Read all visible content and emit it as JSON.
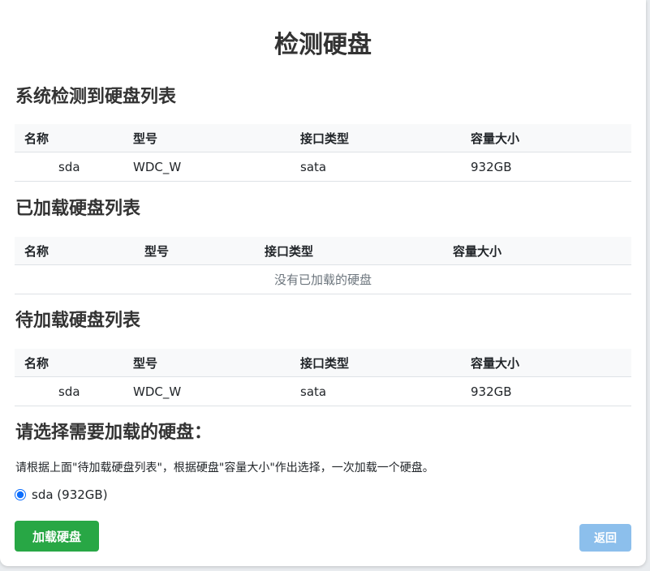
{
  "page_title": "检测硬盘",
  "detected": {
    "title": "系统检测到硬盘列表",
    "columns": [
      "名称",
      "型号",
      "接口类型",
      "容量大小"
    ],
    "rows": [
      {
        "name": "sda",
        "model": "WDC_W",
        "interface": "sata",
        "capacity": "932GB"
      }
    ]
  },
  "mounted": {
    "title": "已加载硬盘列表",
    "columns": [
      "名称",
      "型号",
      "接口类型",
      "容量大小"
    ],
    "empty_text": "没有已加载的硬盘"
  },
  "pending": {
    "title": "待加载硬盘列表",
    "columns": [
      "名称",
      "型号",
      "接口类型",
      "容量大小"
    ],
    "rows": [
      {
        "name": "sda",
        "model": "WDC_W",
        "interface": "sata",
        "capacity": "932GB"
      }
    ]
  },
  "select": {
    "title": "请选择需要加载的硬盘：",
    "instruction": "请根据上面\"待加载硬盘列表\"，根据硬盘\"容量大小\"作出选择，一次加载一个硬盘。",
    "options": [
      {
        "label": "sda (932GB)",
        "selected": true
      }
    ]
  },
  "buttons": {
    "mount_label": "加载硬盘",
    "back_label": "返回"
  },
  "colors": {
    "mount_button": "#28a745",
    "back_button": "#8cbfec",
    "table_header_bg": "#f8f9fa"
  }
}
